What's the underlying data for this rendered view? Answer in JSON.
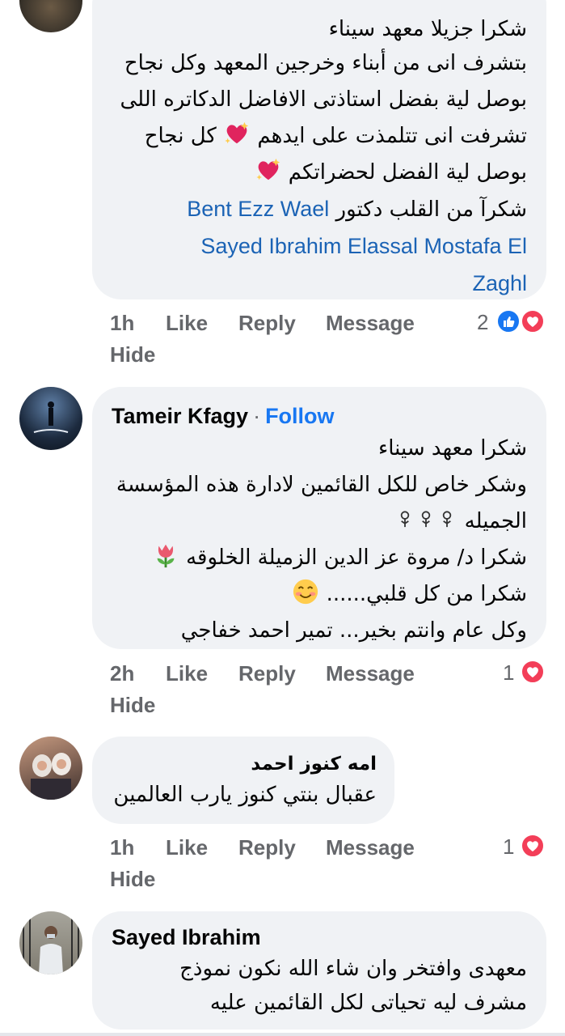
{
  "comments": [
    {
      "lines": [
        "شكرا جزيلا معهد سيناء",
        "بتشرف انى من أبناء وخرجين المعهد وكل نجاح",
        "بوصل لية بفضل استاذتى الافاضل الدكاتره اللى",
        "تشرفت انى تتلمذت على ايدهم",
        "كل نجاح",
        "بوصل لية الفضل لحضراتكم",
        "شكرآ من القلب دكتور"
      ],
      "mentions": [
        "Bent Ezz Wael",
        "Sayed Ibrahim Elassal Mostafa El",
        "Zaghl"
      ],
      "actions": {
        "time": "1h",
        "like": "Like",
        "reply": "Reply",
        "message": "Message",
        "hide": "Hide"
      },
      "reaction_count": "2"
    },
    {
      "author": "Tameir Kfagy",
      "separator": "·",
      "follow": "Follow",
      "lines": [
        "شكرا معهد سيناء",
        "وشكر خاص للكل القائمين لادارة هذه المؤسسة",
        "الجميله",
        "شكرا د/ مروة عز الدين الزميلة الخلوقه",
        "شكرا من كل قلبي......",
        "وكل عام وانتم بخير... تمير احمد خفاجي"
      ],
      "actions": {
        "time": "2h",
        "like": "Like",
        "reply": "Reply",
        "message": "Message",
        "hide": "Hide"
      },
      "reaction_count": "1"
    },
    {
      "author": "امه كنوز احمد",
      "lines": [
        "عقبال بنتي كنوز يارب العالمين"
      ],
      "actions": {
        "time": "1h",
        "like": "Like",
        "reply": "Reply",
        "message": "Message",
        "hide": "Hide"
      },
      "reaction_count": "1"
    },
    {
      "author": "Sayed Ibrahim",
      "lines": [
        "معهدى وافتخر وان شاء الله نكون نموذج",
        "مشرف ليه تحياتى لكل القائمين عليه"
      ]
    }
  ],
  "icons": {
    "like_reaction": "like-icon",
    "love_reaction": "heart-icon",
    "sparkling_heart": "sparkling-heart-icon",
    "flower": "rosette-icon",
    "tulip": "tulip-icon",
    "smile": "smiling-face-icon"
  },
  "colors": {
    "bubble": "#f0f2f5",
    "link": "#1877f2",
    "mention": "#1b63b5",
    "muted": "#65676b",
    "love": "#f33e58"
  }
}
